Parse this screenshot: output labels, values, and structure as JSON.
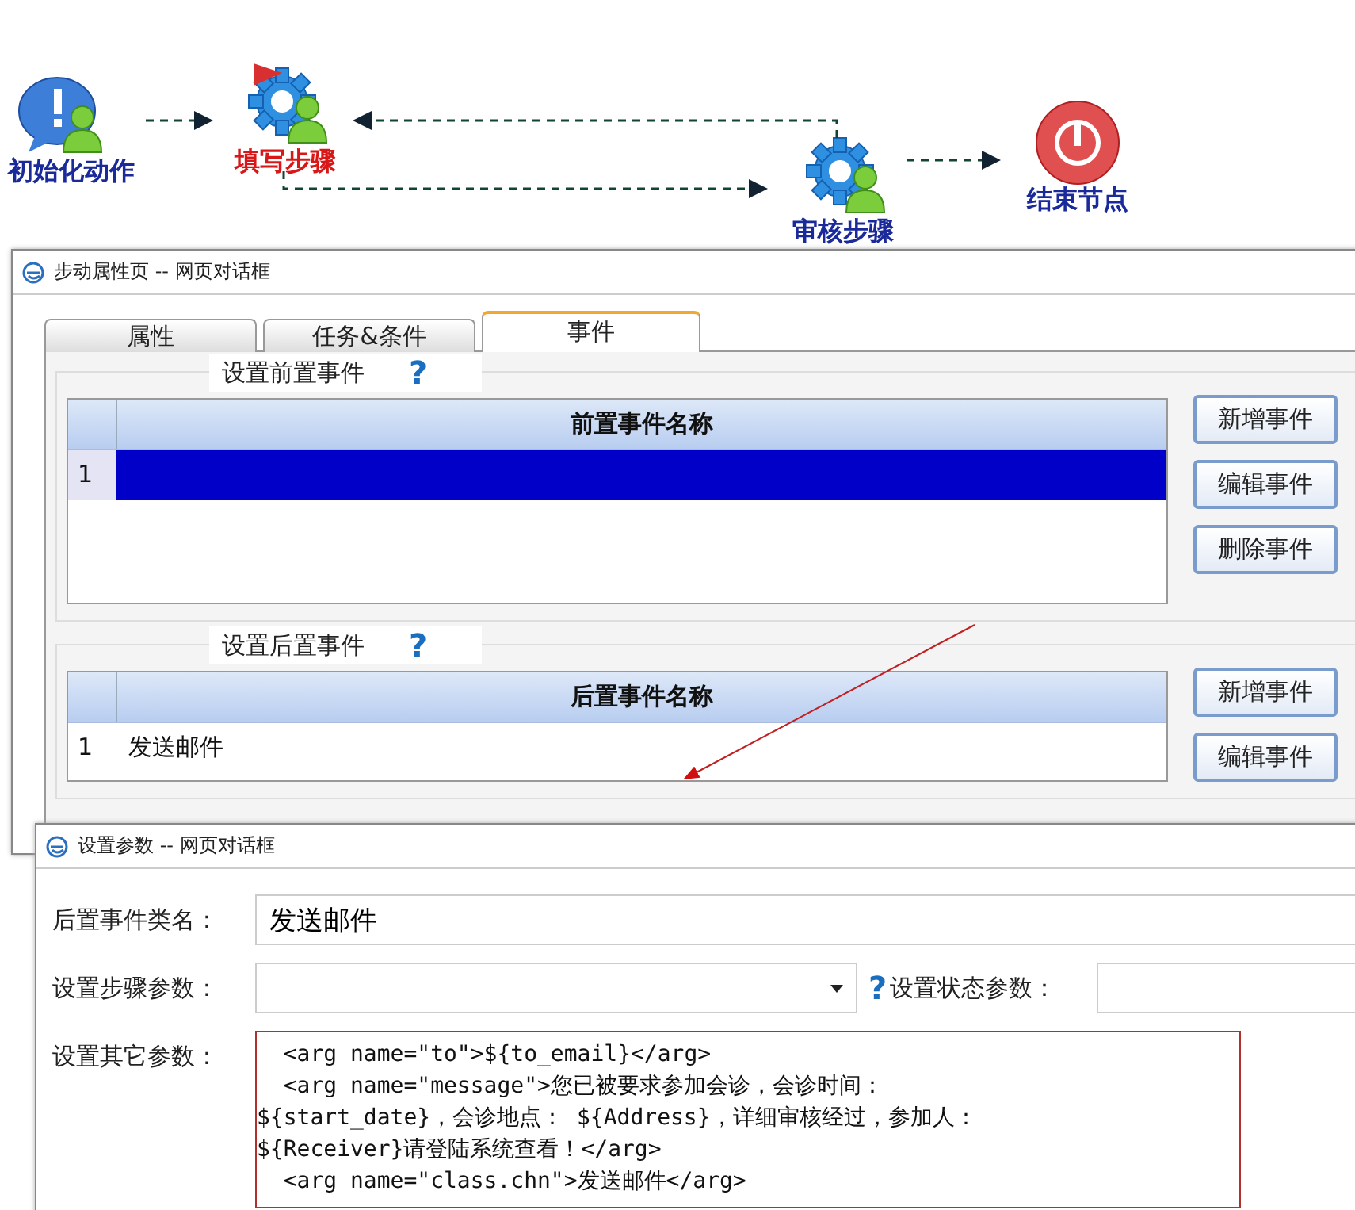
{
  "workflow": {
    "nodes": [
      {
        "kind": "info",
        "label": "初始化动作",
        "selected": false
      },
      {
        "kind": "flag-gear",
        "label": "填写步骤",
        "selected": true
      },
      {
        "kind": "gear",
        "label": "审核步骤",
        "selected": false
      },
      {
        "kind": "stop",
        "label": "结束节点",
        "selected": false
      }
    ]
  },
  "step_dialog": {
    "title": "步动属性页 -- 网页对话框",
    "tabs": [
      {
        "label": "属性",
        "selected": false
      },
      {
        "label": "任务&条件",
        "selected": false
      },
      {
        "label": "事件",
        "selected": true
      }
    ],
    "sections": [
      {
        "legend": "设置前置事件",
        "help": "?",
        "column": "前置事件名称",
        "rows": [
          {
            "index": "1",
            "name": "",
            "selected": true
          }
        ],
        "buttons": [
          "新增事件",
          "编辑事件",
          "删除事件"
        ]
      },
      {
        "legend": "设置后置事件",
        "help": "?",
        "column": "后置事件名称",
        "rows": [
          {
            "index": "1",
            "name": "发送邮件",
            "selected": false
          }
        ],
        "buttons": [
          "新增事件",
          "编辑事件"
        ]
      }
    ]
  },
  "param_dialog": {
    "title": "设置参数 -- 网页对话框",
    "class_name": {
      "label": "后置事件类名：",
      "value": "发送邮件"
    },
    "step_param": {
      "label": "设置步骤参数："
    },
    "help": "?",
    "state_param": {
      "label": "设置状态参数："
    },
    "other_params": {
      "label": "设置其它参数：",
      "lines": [
        "  <arg name=\"to\">${to_email}</arg>",
        "  <arg name=\"message\">您已被要求参加会诊，会诊时间：",
        "${start_date}，会诊地点： ${Address}，详细审核经过，参加人：",
        "${Receiver}请登陆系统查看！</arg>",
        "  <arg name=\"class.chn\">发送邮件</arg>"
      ]
    }
  }
}
